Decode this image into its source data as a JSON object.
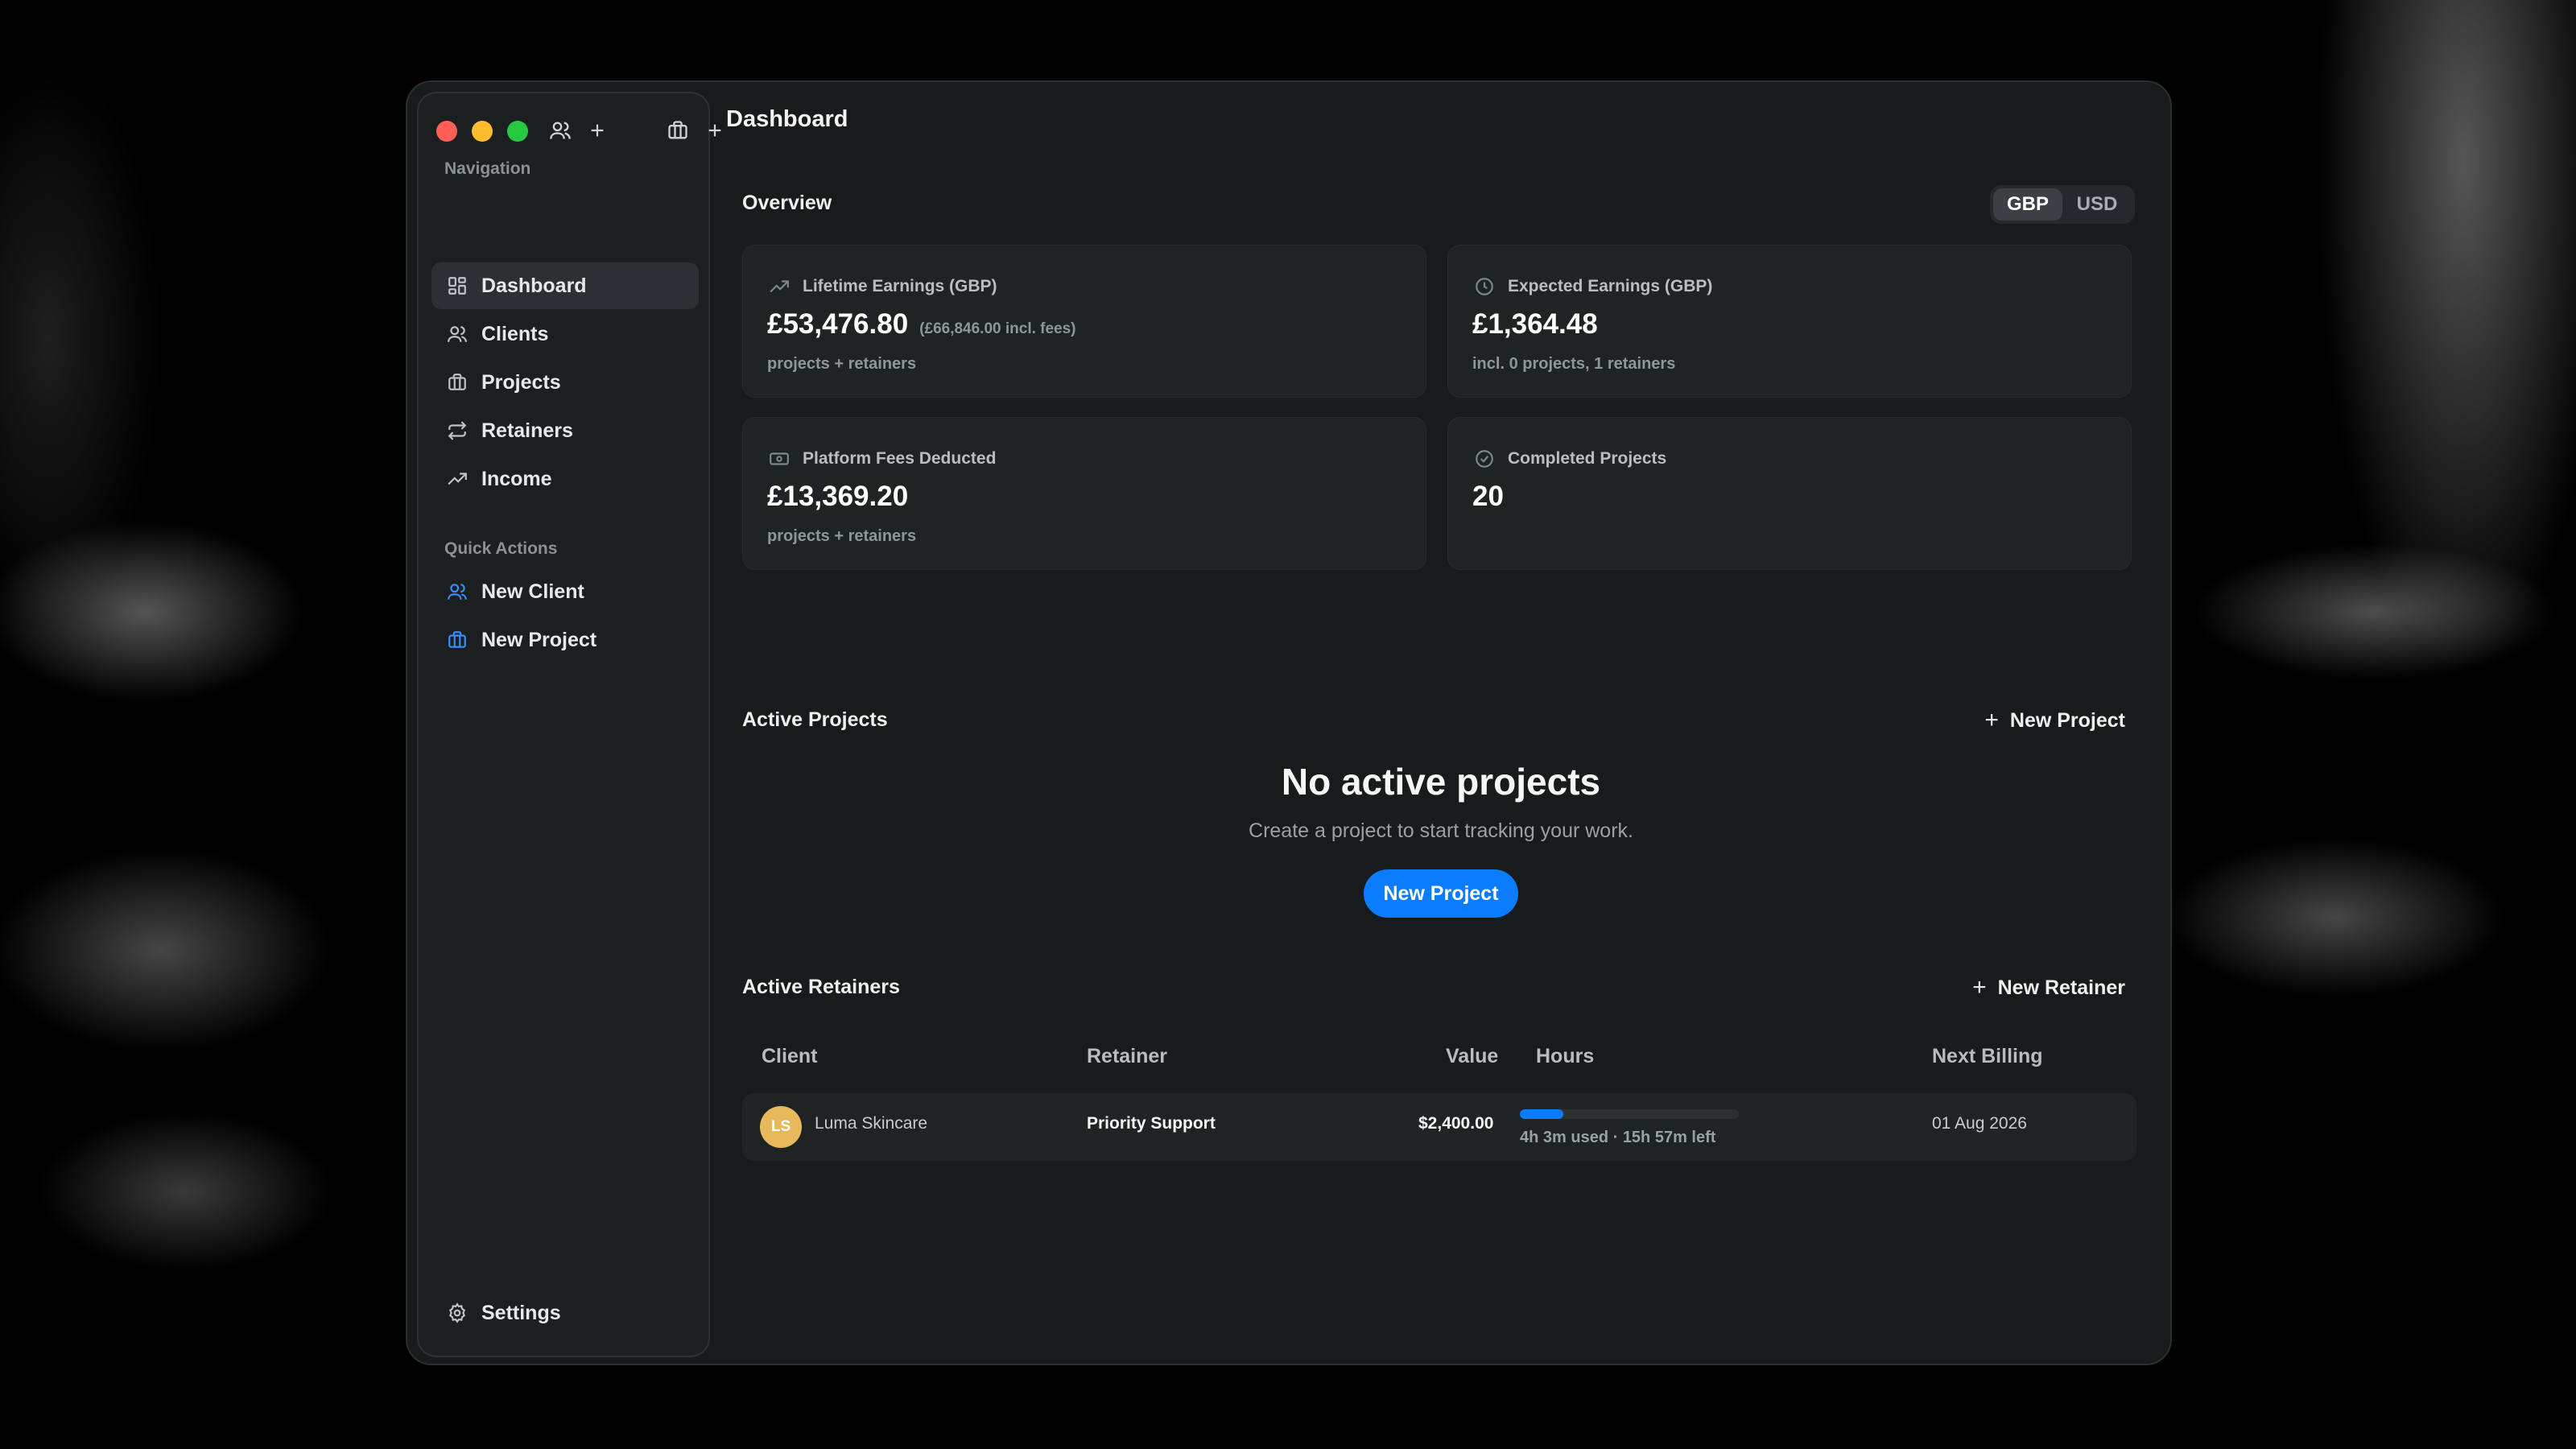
{
  "sidebar": {
    "navigation_heading": "Navigation",
    "items": [
      {
        "label": "Dashboard",
        "icon": "grid-icon",
        "active": true
      },
      {
        "label": "Clients",
        "icon": "users-icon"
      },
      {
        "label": "Projects",
        "icon": "briefcase-icon"
      },
      {
        "label": "Retainers",
        "icon": "repeat-icon"
      },
      {
        "label": "Income",
        "icon": "trending-up-icon"
      }
    ],
    "quick_actions_heading": "Quick Actions",
    "quick_actions": [
      {
        "label": "New Client",
        "icon": "users-icon"
      },
      {
        "label": "New Project",
        "icon": "briefcase-icon"
      }
    ],
    "settings_label": "Settings"
  },
  "header": {
    "title": "Dashboard"
  },
  "overview": {
    "title": "Overview",
    "currency": {
      "options": [
        "GBP",
        "USD"
      ],
      "selected": "GBP"
    },
    "cards": [
      {
        "label": "Lifetime Earnings (GBP)",
        "value": "£53,476.80",
        "extra": "(£66,846.00 incl. fees)",
        "sub": "projects + retainers",
        "icon": "trending-up-icon"
      },
      {
        "label": "Expected Earnings (GBP)",
        "value": "£1,364.48",
        "sub": "incl. 0 projects, 1 retainers",
        "icon": "clock-icon"
      },
      {
        "label": "Platform Fees Deducted",
        "value": "£13,369.20",
        "sub": "projects + retainers",
        "icon": "banknote-icon"
      },
      {
        "label": "Completed Projects",
        "value": "20",
        "icon": "check-circle-icon"
      }
    ]
  },
  "active_projects": {
    "title": "Active Projects",
    "new_label": "New Project",
    "empty_title": "No active projects",
    "empty_sub": "Create a project to start tracking your work.",
    "empty_button": "New Project"
  },
  "active_retainers": {
    "title": "Active Retainers",
    "new_label": "New Retainer",
    "columns": {
      "client": "Client",
      "retainer": "Retainer",
      "value": "Value",
      "hours": "Hours",
      "next_billing": "Next Billing"
    },
    "rows": [
      {
        "initials": "LS",
        "client": "Luma Skincare",
        "retainer": "Priority Support",
        "value": "$2,400.00",
        "hours_used_fraction": 0.2,
        "hours_text": "4h 3m used · 15h 57m left",
        "next_billing": "01 Aug 2026"
      }
    ]
  },
  "colors": {
    "accent": "#0a7cff",
    "avatar": "#e8b95a"
  }
}
